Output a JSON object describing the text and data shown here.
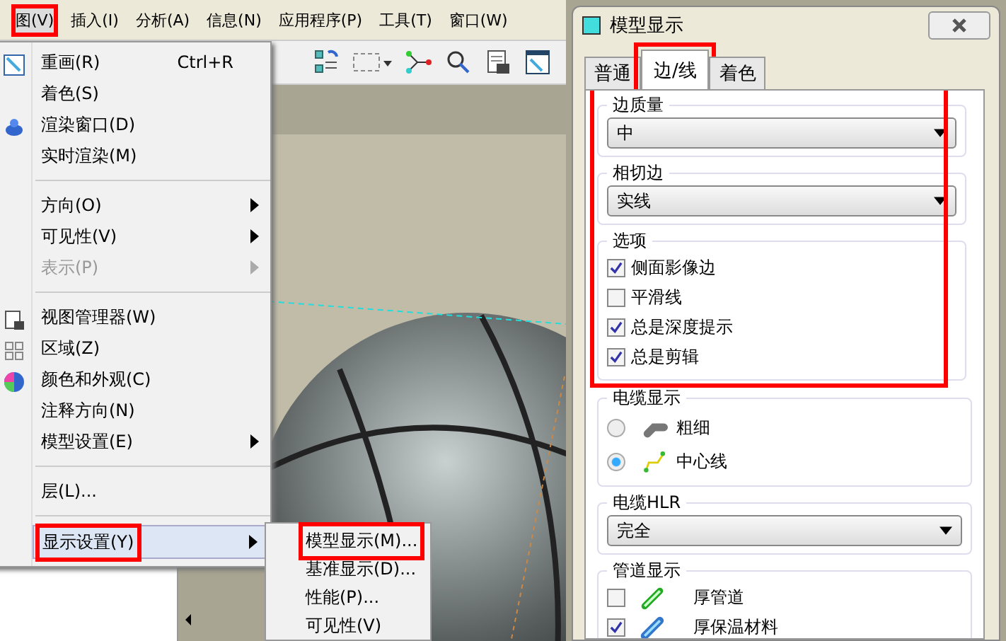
{
  "menubar": [
    {
      "label": "图(V)",
      "selected": true,
      "annotated": true
    },
    {
      "label": "插入(I)",
      "selected": false,
      "annotated": false
    },
    {
      "label": "分析(A)",
      "selected": false,
      "annotated": false
    },
    {
      "label": "信息(N)",
      "selected": false,
      "annotated": false
    },
    {
      "label": "应用程序(P)",
      "selected": false,
      "annotated": false
    },
    {
      "label": "工具(T)",
      "selected": false,
      "annotated": false
    },
    {
      "label": "窗口(W)",
      "selected": false,
      "annotated": false
    }
  ],
  "view_menu": {
    "items": [
      {
        "kind": "item",
        "label": "重画(R)",
        "shortcut": "Ctrl+R",
        "submenu": false,
        "disabled": false,
        "selected": false,
        "annotated": false
      },
      {
        "kind": "item",
        "label": "着色(S)",
        "submenu": false,
        "disabled": false,
        "selected": false,
        "annotated": false
      },
      {
        "kind": "item",
        "label": "渲染窗口(D)",
        "submenu": false,
        "disabled": false,
        "selected": false,
        "annotated": false
      },
      {
        "kind": "item",
        "label": "实时渲染(M)",
        "submenu": false,
        "disabled": false,
        "selected": false,
        "annotated": false
      },
      {
        "kind": "separator"
      },
      {
        "kind": "item",
        "label": "方向(O)",
        "submenu": true,
        "disabled": false,
        "selected": false,
        "annotated": false
      },
      {
        "kind": "item",
        "label": "可见性(V)",
        "submenu": true,
        "disabled": false,
        "selected": false,
        "annotated": false
      },
      {
        "kind": "item",
        "label": "表示(P)",
        "submenu": true,
        "disabled": true,
        "selected": false,
        "annotated": false
      },
      {
        "kind": "separator"
      },
      {
        "kind": "item",
        "label": "视图管理器(W)",
        "submenu": false,
        "disabled": false,
        "selected": false,
        "annotated": false
      },
      {
        "kind": "item",
        "label": "区域(Z)",
        "submenu": false,
        "disabled": false,
        "selected": false,
        "annotated": false
      },
      {
        "kind": "item",
        "label": "颜色和外观(C)",
        "submenu": false,
        "disabled": false,
        "selected": false,
        "annotated": false
      },
      {
        "kind": "item",
        "label": "注释方向(N)",
        "submenu": false,
        "disabled": false,
        "selected": false,
        "annotated": false
      },
      {
        "kind": "item",
        "label": "模型设置(E)",
        "submenu": true,
        "disabled": false,
        "selected": false,
        "annotated": false
      },
      {
        "kind": "separator"
      },
      {
        "kind": "item",
        "label": "层(L)...",
        "submenu": false,
        "disabled": false,
        "selected": false,
        "annotated": false
      },
      {
        "kind": "separator"
      },
      {
        "kind": "item",
        "label": "显示设置(Y)",
        "submenu": true,
        "disabled": false,
        "selected": true,
        "annotated": true
      }
    ]
  },
  "display_submenu": {
    "items": [
      {
        "label": "模型显示(M)...",
        "annotated": true
      },
      {
        "label": "基准显示(D)...",
        "annotated": false
      },
      {
        "label": "性能(P)...",
        "annotated": false
      },
      {
        "label": "可见性(V)",
        "annotated": false
      }
    ]
  },
  "dialog": {
    "title": "模型显示",
    "tabs": [
      {
        "label": "普通",
        "selected": false,
        "annotated": false
      },
      {
        "label": "边/线",
        "selected": true,
        "annotated": true
      },
      {
        "label": "着色",
        "selected": false,
        "annotated": false
      }
    ],
    "edge_section_annotated": true,
    "edge_quality": {
      "label": "边质量",
      "value": "中"
    },
    "tangent_edges": {
      "label": "相切边",
      "value": "实线"
    },
    "options": {
      "label": "选项",
      "items": [
        {
          "label": "侧面影像边",
          "checked": true
        },
        {
          "label": "平滑线",
          "checked": false
        },
        {
          "label": "总是深度提示",
          "checked": true
        },
        {
          "label": "总是剪辑",
          "checked": true
        }
      ]
    },
    "cable_display": {
      "label": "电缆显示",
      "options": [
        {
          "kind": "thick",
          "label": "粗细",
          "selected": false
        },
        {
          "kind": "centerline",
          "label": "中心线",
          "selected": true
        }
      ]
    },
    "cable_hlr": {
      "label": "电缆HLR",
      "value": "完全"
    },
    "piping_display": {
      "label": "管道显示",
      "items": [
        {
          "kind": "pipe",
          "label": "厚管道",
          "checked": false
        },
        {
          "kind": "insulation",
          "label": "厚保温材料",
          "checked": true
        }
      ]
    }
  }
}
